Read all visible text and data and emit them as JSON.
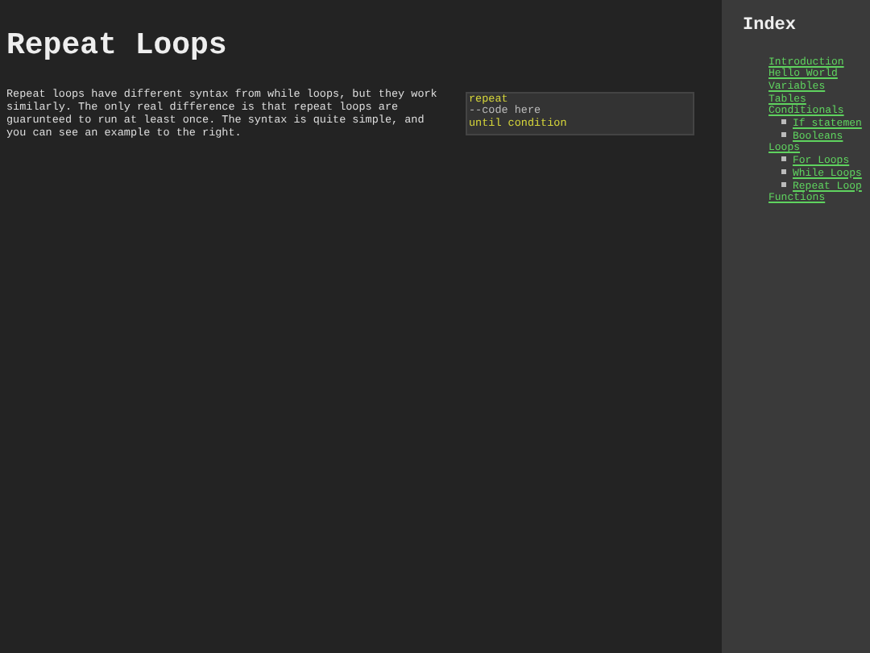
{
  "main": {
    "title": "Repeat Loops",
    "text": "Repeat loops have different syntax from while loops, but they work similarly. The only real difference is that repeat loops are guarunteed to run at least once. The syntax is quite simple, and you can see an example to the right.",
    "code": [
      {
        "kind": "keyword",
        "text": "repeat"
      },
      {
        "kind": "comment",
        "text": "--code here"
      },
      {
        "kind": "keyword",
        "text": "until condition"
      }
    ]
  },
  "sidebar": {
    "title": "Index",
    "items": [
      {
        "label": "Introduction"
      },
      {
        "label": "Hello World"
      },
      {
        "label": "Variables"
      },
      {
        "label": "Tables"
      },
      {
        "label": "Conditionals",
        "children": [
          {
            "label": "If statemen"
          },
          {
            "label": "Booleans"
          }
        ]
      },
      {
        "label": "Loops",
        "children": [
          {
            "label": "For Loops"
          },
          {
            "label": "While Loops"
          },
          {
            "label": "Repeat Loop"
          }
        ]
      },
      {
        "label": "Functions"
      }
    ]
  }
}
